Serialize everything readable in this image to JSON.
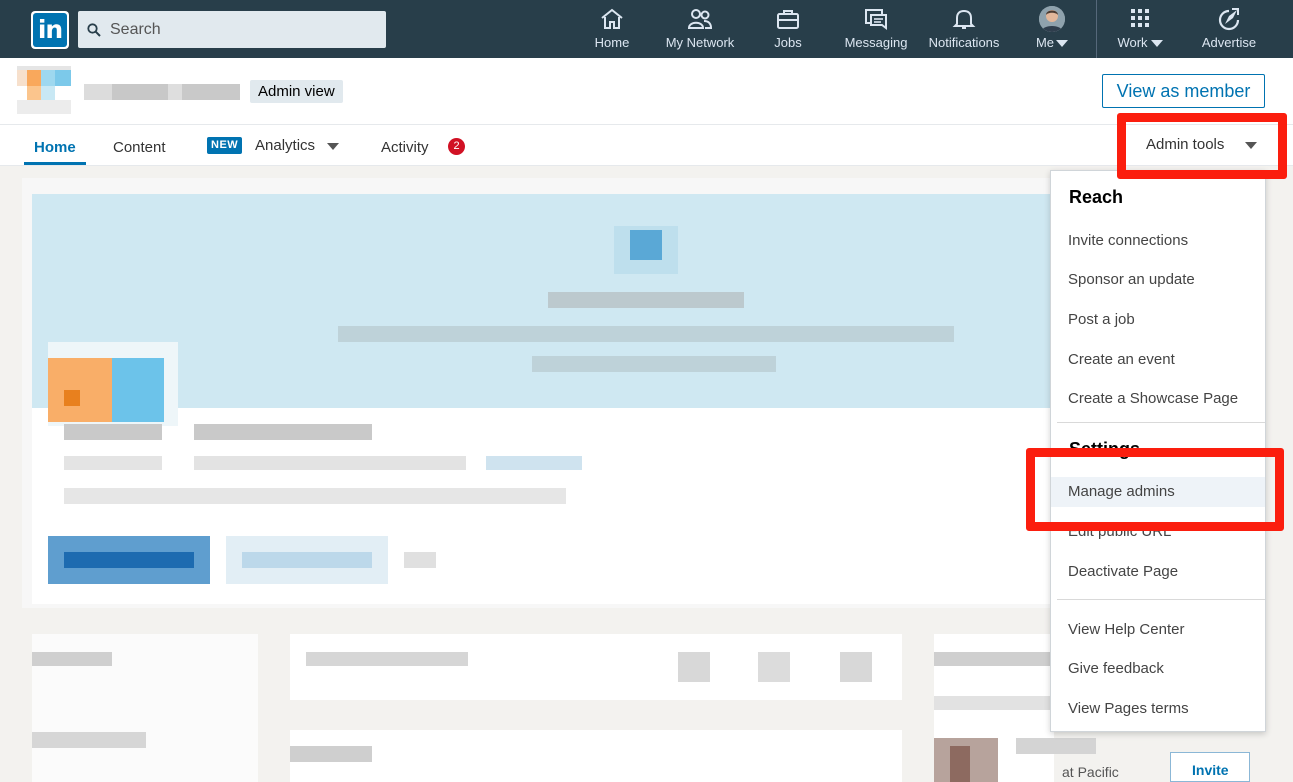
{
  "nav": {
    "logo": "in",
    "search_placeholder": "Search",
    "items": [
      {
        "label": "Home",
        "icon": "home-icon"
      },
      {
        "label": "My Network",
        "icon": "people-icon"
      },
      {
        "label": "Jobs",
        "icon": "briefcase-icon"
      },
      {
        "label": "Messaging",
        "icon": "messages-icon"
      },
      {
        "label": "Notifications",
        "icon": "bell-icon"
      },
      {
        "label": "Me",
        "icon": "avatar"
      },
      {
        "label": "Work",
        "icon": "grid-icon"
      },
      {
        "label": "Advertise",
        "icon": "compass-icon"
      }
    ]
  },
  "header": {
    "badge": "Admin view",
    "view_as_member": "View as member"
  },
  "subnav": {
    "tabs": [
      {
        "label": "Home",
        "active": true
      },
      {
        "label": "Content"
      },
      {
        "label": "Analytics",
        "badge": "NEW"
      },
      {
        "label": "Activity",
        "count": "2"
      }
    ],
    "admin_tools": "Admin tools"
  },
  "dropdown": {
    "reach_heading": "Reach",
    "reach_items": [
      "Invite connections",
      "Sponsor an update",
      "Post a job",
      "Create an event",
      "Create a Showcase Page"
    ],
    "settings_heading": "Settings",
    "settings_items": [
      "Manage admins",
      "Edit public URL",
      "Deactivate Page"
    ],
    "help_items": [
      "View Help Center",
      "Give feedback",
      "View Pages terms"
    ]
  },
  "partial_text": {
    "company_fragment": "at Pacific",
    "invite_button": "Invite"
  },
  "colors": {
    "nav_bg": "#283e4a",
    "brand_blue": "#0073b1",
    "highlight_red": "#fb1e0e",
    "badge_red": "#d11124"
  }
}
